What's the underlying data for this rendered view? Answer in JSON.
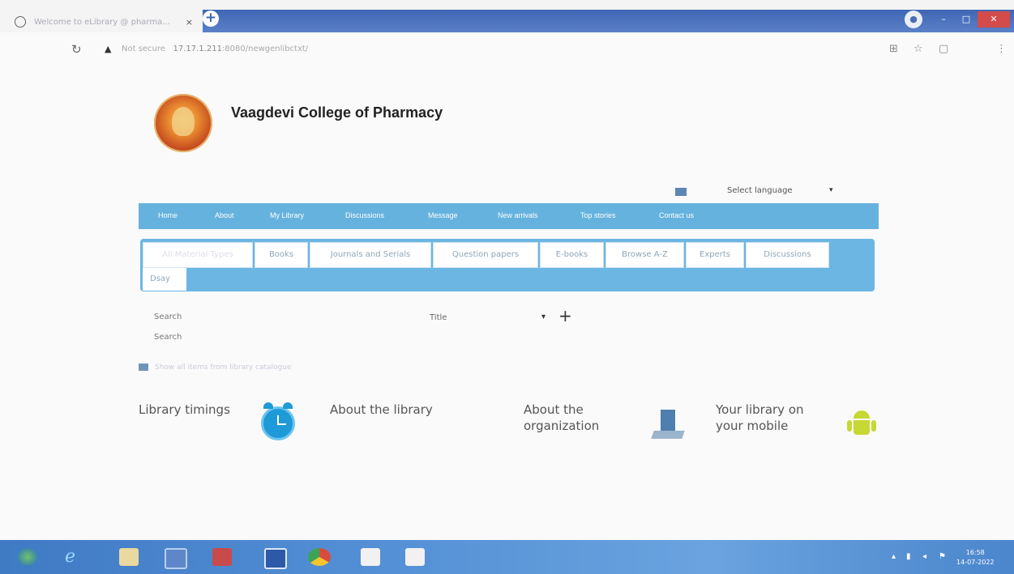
{
  "browser": {
    "tab_title": "Welcome to eLibrary @ pharma...",
    "tab_close": "×",
    "new_tab": "+",
    "address": {
      "security_label": "Not secure",
      "url_host": "17.17.1.211",
      "url_path": ":8080/newgenlibctxt/"
    }
  },
  "site": {
    "title": "Vaagdevi College of Pharmacy"
  },
  "language": {
    "selected": "Select language",
    "arrow": "▾"
  },
  "main_nav": [
    "Home",
    "About",
    "My Library",
    "Discussions",
    "Message",
    "New arrivals",
    "Top stories",
    "Contact us"
  ],
  "search_tabs": [
    "All Material Types",
    "Books",
    "Journals and Serials",
    "Question papers",
    "E-books",
    "Browse A-Z",
    "Experts",
    "Discussions"
  ],
  "search_tabs_row2": [
    "Dsay"
  ],
  "search": {
    "label_1": "Search",
    "label_2": "Search",
    "field_selected": "Title",
    "field_arrow": "▾",
    "add": "+"
  },
  "folder_link": "Show all items from library catalogue",
  "info_blocks": {
    "timings": "Library timings",
    "about_library": "About the library",
    "about_org": "About the organization",
    "mobile": "Your library on your mobile"
  },
  "taskbar": {
    "time": "16:58",
    "date": "14-07-2022"
  }
}
